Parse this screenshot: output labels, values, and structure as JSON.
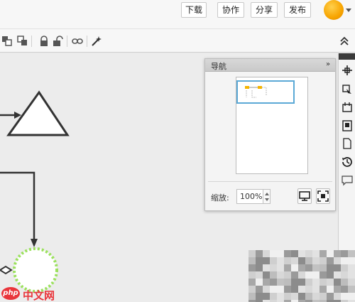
{
  "header": {
    "buttons": [
      {
        "id": "download",
        "label": "下载"
      },
      {
        "id": "collaborate",
        "label": "协作"
      },
      {
        "id": "share",
        "label": "分享"
      },
      {
        "id": "publish",
        "label": "发布"
      }
    ]
  },
  "toolbar": {
    "tools": [
      "bring-to-front-icon",
      "send-to-back-icon",
      "lock-icon",
      "unlock-icon",
      "link-icon",
      "magic-wand-icon",
      "collapse-up-icon"
    ]
  },
  "navigator": {
    "title": "导航",
    "collapse_glyph": "»",
    "zoom_label": "缩放:",
    "zoom_value": "100%"
  },
  "rightbar": {
    "icons": [
      "navigator-icon",
      "format-icon",
      "page-settings-icon",
      "page-list-icon",
      "document-icon",
      "history-icon",
      "comment-icon"
    ]
  },
  "watermark": {
    "logo_text": "php",
    "site_text": "中文网"
  },
  "colors": {
    "accent_blue": "#5ba9d6",
    "selection_green": "#9be15d",
    "watermark_red": "#e9353b"
  }
}
